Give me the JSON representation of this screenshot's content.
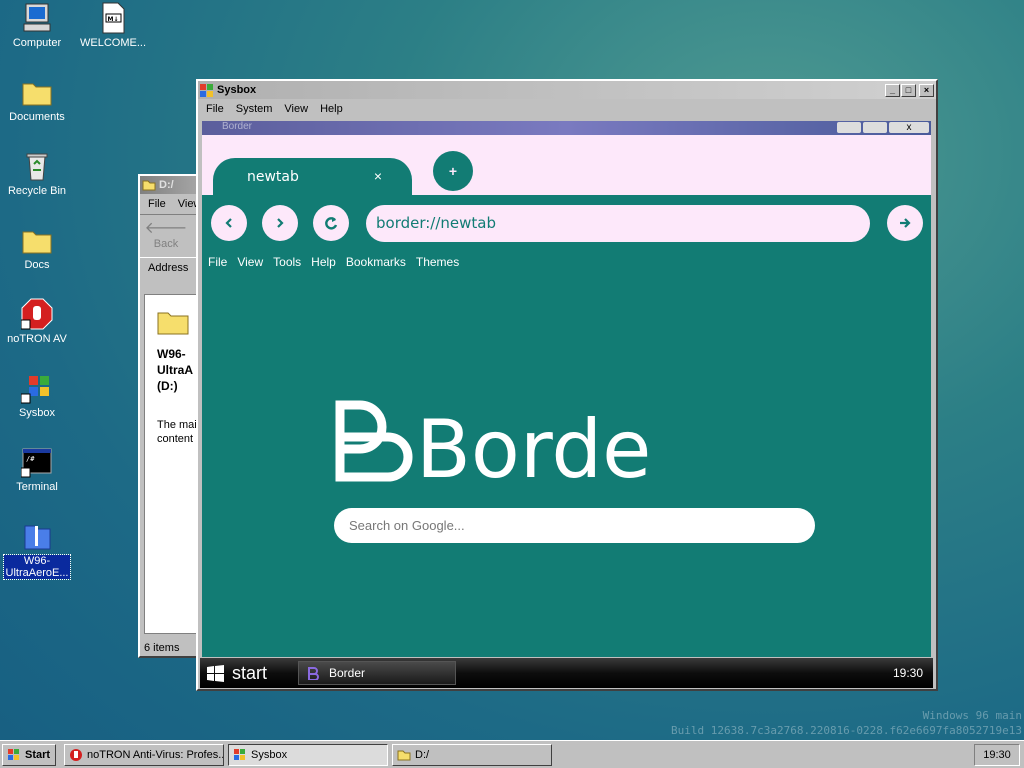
{
  "desktop": {
    "icons": [
      {
        "label": "Computer"
      },
      {
        "label": "WELCOME..."
      },
      {
        "label": "Documents"
      },
      {
        "label": "Recycle Bin"
      },
      {
        "label": "Docs"
      },
      {
        "label": "noTRON AV"
      },
      {
        "label": "Sysbox"
      },
      {
        "label": "Terminal"
      },
      {
        "label": "W96-\nUltraAeroE..."
      }
    ],
    "watermark_line1": "Windows 96 main",
    "watermark_line2": "Build 12638.7c3a2768.220816-0228.f62e6697fa8052719e13"
  },
  "explorer": {
    "title": "D:/",
    "menu": [
      "File",
      "View"
    ],
    "back_label": "Back",
    "address_label": "Address",
    "drive_label": "W96-\nUltraA\n(D:)",
    "info_text": "The mai\ncontent",
    "status": "6 items"
  },
  "sysbox": {
    "title": "Sysbox",
    "menu": [
      "File",
      "System",
      "View",
      "Help"
    ]
  },
  "browser": {
    "inner_title": "Border",
    "tab_label": "newtab",
    "tab_close": "×",
    "new_tab": "+",
    "url": "border://newtab",
    "menu": [
      "File",
      "View",
      "Tools",
      "Help",
      "Bookmarks",
      "Themes"
    ],
    "logo_text": "Border",
    "search_placeholder": "Search on Google...",
    "colors": {
      "accent": "#127c74",
      "light": "#fde8fa"
    }
  },
  "inner_taskbar": {
    "start_label": "start",
    "task_label": "Border",
    "clock": "19:30"
  },
  "taskbar": {
    "start_label": "Start",
    "items": [
      "noTRON Anti-Virus: Profes...",
      "Sysbox",
      "D:/"
    ],
    "clock": "19:30"
  }
}
